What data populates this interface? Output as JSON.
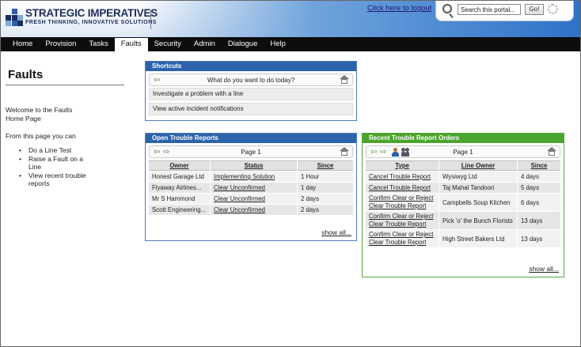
{
  "brand": {
    "title": "STRATEGIC IMPERATIVES",
    "tagline": "FRESH THINKING, INNOVATIVE SOLUTIONS",
    "colors": {
      "navy": "#1c2d5b",
      "blue": "#2f5ea8"
    }
  },
  "header": {
    "logout_label": "Click here to logout",
    "search": {
      "value": "Search this portal...",
      "go_label": "Go!"
    }
  },
  "nav": {
    "items": [
      {
        "label": "Home"
      },
      {
        "label": "Provision"
      },
      {
        "label": "Tasks"
      },
      {
        "label": "Faults",
        "active": true
      },
      {
        "label": "Security"
      },
      {
        "label": "Admin"
      },
      {
        "label": "Dialogue"
      },
      {
        "label": "Help"
      }
    ]
  },
  "page": {
    "title": "Faults",
    "welcome": "Welcome to the Faults Home Page",
    "intro": "From this page you can",
    "bullets": [
      "Do a Line Test",
      "Raise a Fault on a Line",
      "View recent trouble reports"
    ]
  },
  "shortcuts": {
    "title": "Shortcuts",
    "question": "What do you want to do today?",
    "items": [
      "Investigate a problem with a line",
      "View active incident notifications"
    ]
  },
  "open_reports": {
    "title": "Open Trouble Reports",
    "page_label": "Page 1",
    "columns": [
      "Owner",
      "Status",
      "Since"
    ],
    "rows": [
      {
        "owner": "Honest Garage Ltd",
        "status": "Implementing Solution",
        "since": "1 Hour"
      },
      {
        "owner": "Flyaway Airlines...",
        "status": "Clear Unconfirmed",
        "since": "1 day"
      },
      {
        "owner": "Mr S Hammond",
        "status": "Clear Unconfirmed",
        "since": "2 days"
      },
      {
        "owner": "Scott Engineering...",
        "status": "Clear Unconfirmed",
        "since": "2 days"
      }
    ],
    "show_all": "show all..."
  },
  "recent_orders": {
    "title": "Recent Trouble Report Orders",
    "page_label": "Page 1",
    "columns": [
      "Type",
      "Line Owner",
      "Since"
    ],
    "rows": [
      {
        "type": "Cancel Trouble Report",
        "owner": "Wysiwyg Ltd",
        "since": "4 days"
      },
      {
        "type": "Cancel Trouble Report",
        "owner": "Taj Mahal Tandoori",
        "since": "5 days"
      },
      {
        "type": "Confirm Clear or Reject Clear Trouble Report",
        "owner": "Campbells Soup Kitchen",
        "since": "6 days"
      },
      {
        "type": "Confirm Clear or Reject Clear Trouble Report",
        "owner": "Pick 'o' the Bunch Florists",
        "since": "13 days"
      },
      {
        "type": "Confirm Clear or Reject Clear Trouble Report",
        "owner": "High Street Bakers Ltd",
        "since": "13 days"
      }
    ],
    "show_all": "show all..."
  }
}
